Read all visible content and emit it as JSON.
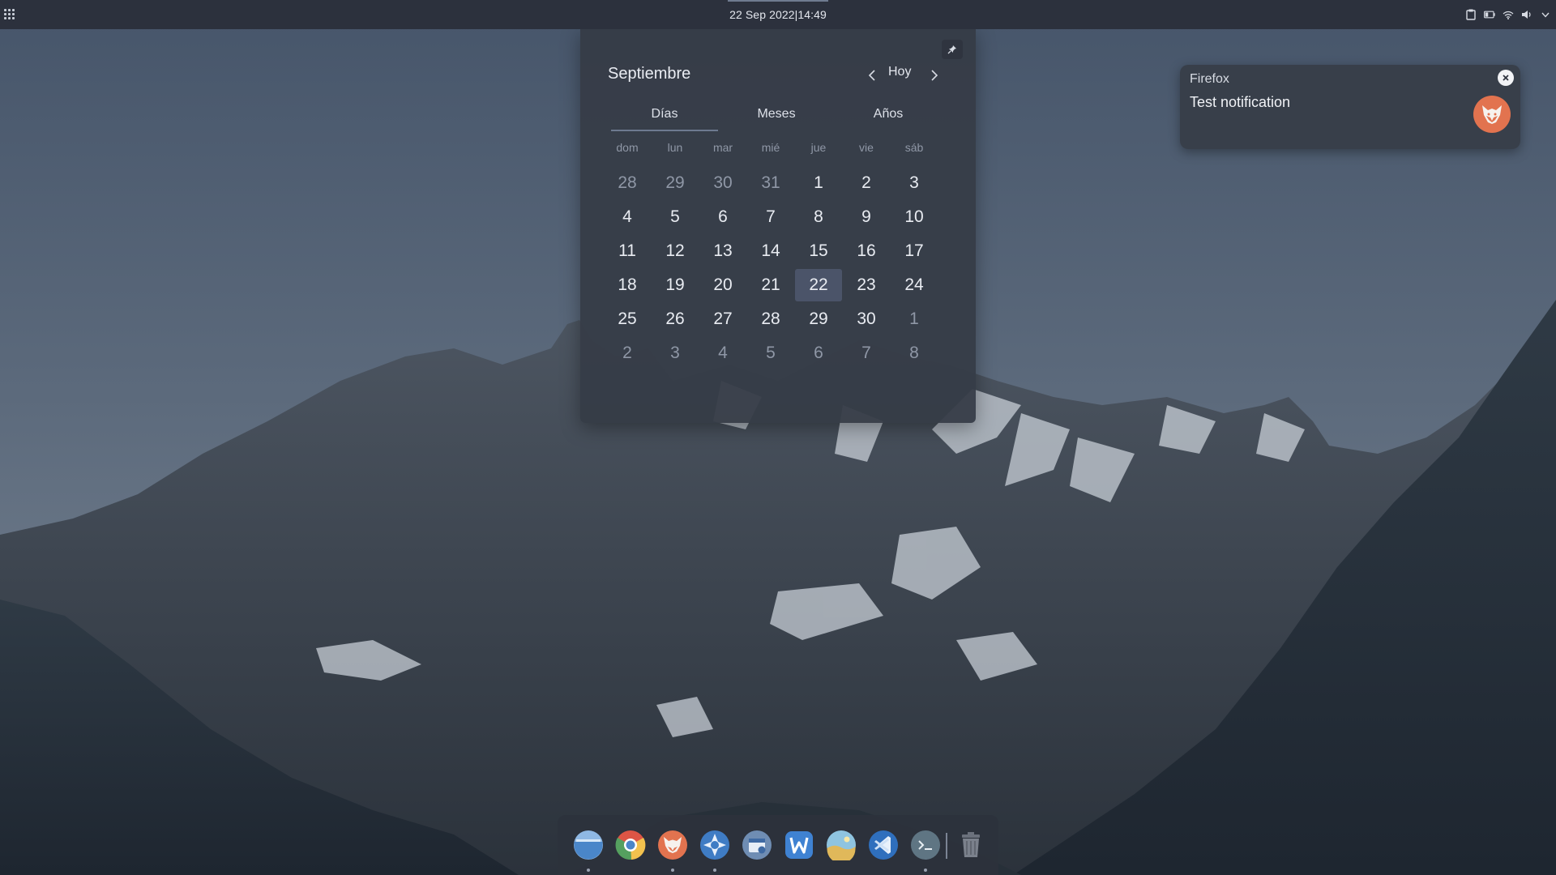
{
  "top_panel": {
    "clock": "22 Sep 2022|14:49",
    "tray_icons": [
      "clipboard-icon",
      "battery-icon",
      "wifi-icon",
      "volume-icon",
      "chevron-down-icon"
    ]
  },
  "calendar": {
    "month": "Septiembre",
    "today_label": "Hoy",
    "tabs": [
      "Días",
      "Meses",
      "Años"
    ],
    "active_tab": "Días",
    "weekdays": [
      "dom",
      "lun",
      "mar",
      "mié",
      "jue",
      "vie",
      "sáb"
    ],
    "selected_day": "22",
    "weeks": [
      [
        {
          "d": "28",
          "other": true
        },
        {
          "d": "29",
          "other": true
        },
        {
          "d": "30",
          "other": true
        },
        {
          "d": "31",
          "other": true
        },
        {
          "d": "1"
        },
        {
          "d": "2"
        },
        {
          "d": "3"
        }
      ],
      [
        {
          "d": "4"
        },
        {
          "d": "5"
        },
        {
          "d": "6"
        },
        {
          "d": "7"
        },
        {
          "d": "8"
        },
        {
          "d": "9"
        },
        {
          "d": "10"
        }
      ],
      [
        {
          "d": "11"
        },
        {
          "d": "12"
        },
        {
          "d": "13"
        },
        {
          "d": "14"
        },
        {
          "d": "15"
        },
        {
          "d": "16"
        },
        {
          "d": "17"
        }
      ],
      [
        {
          "d": "18"
        },
        {
          "d": "19"
        },
        {
          "d": "20"
        },
        {
          "d": "21"
        },
        {
          "d": "22",
          "today": true
        },
        {
          "d": "23"
        },
        {
          "d": "24"
        }
      ],
      [
        {
          "d": "25"
        },
        {
          "d": "26"
        },
        {
          "d": "27"
        },
        {
          "d": "28"
        },
        {
          "d": "29"
        },
        {
          "d": "30"
        },
        {
          "d": "1",
          "other": true
        }
      ],
      [
        {
          "d": "2",
          "other": true
        },
        {
          "d": "3",
          "other": true
        },
        {
          "d": "4",
          "other": true
        },
        {
          "d": "5",
          "other": true
        },
        {
          "d": "6",
          "other": true
        },
        {
          "d": "7",
          "other": true
        },
        {
          "d": "8",
          "other": true
        }
      ]
    ]
  },
  "notification": {
    "app": "Firefox",
    "body": "Test notification",
    "icon": "firefox-icon"
  },
  "dock": {
    "items": [
      {
        "name": "file-manager-icon",
        "running": true
      },
      {
        "name": "chrome-icon",
        "running": false
      },
      {
        "name": "firefox-icon",
        "running": true
      },
      {
        "name": "settings-icon",
        "running": true
      },
      {
        "name": "app-store-icon",
        "running": false
      },
      {
        "name": "writer-icon",
        "running": false
      },
      {
        "name": "image-viewer-icon",
        "running": false
      },
      {
        "name": "vscode-icon",
        "running": false
      },
      {
        "name": "terminal-icon",
        "running": true
      },
      {
        "name": "trash-icon",
        "running": false
      }
    ]
  },
  "colors": {
    "panel": "#2c313d",
    "popover": "#363c47",
    "today_highlight": "#4b5469",
    "firefox_orange": "#e2734f"
  }
}
